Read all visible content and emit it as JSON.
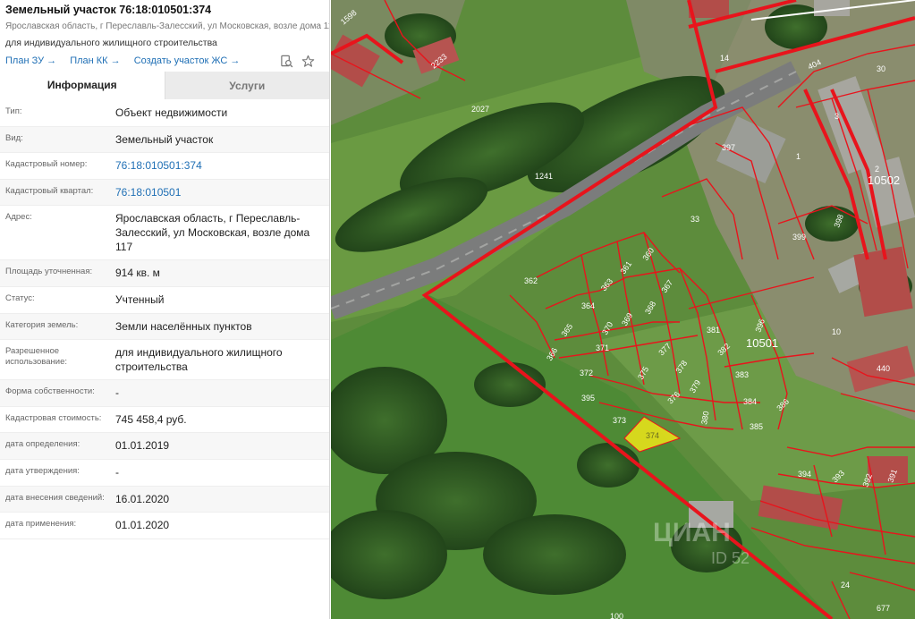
{
  "header": {
    "title": "Земельный участок 76:18:010501:374",
    "address_line": "Ярославская область, г Переславль-Залесский, ул Московская, возле дома 117",
    "purpose": "для индивидуального жилищного строительства",
    "links": [
      {
        "label": "План ЗУ →"
      },
      {
        "label": "План КК →"
      },
      {
        "label": "Создать участок ЖС →"
      }
    ],
    "icons": [
      "document-search-icon",
      "star-icon"
    ]
  },
  "tabs": [
    {
      "label": "Информация",
      "active": true
    },
    {
      "label": "Услуги",
      "active": false
    }
  ],
  "info_rows": [
    {
      "label": "Тип:",
      "value": "Объект недвижимости",
      "link": false
    },
    {
      "label": "Вид:",
      "value": "Земельный участок",
      "link": false
    },
    {
      "label": "Кадастровый номер:",
      "value": "76:18:010501:374",
      "link": true
    },
    {
      "label": "Кадастровый квартал:",
      "value": "76:18:010501",
      "link": true
    },
    {
      "label": "Адрес:",
      "value": "Ярославская область, г Переславль-Залесский, ул Московская, возле дома 117",
      "link": false
    },
    {
      "label": "Площадь уточненная:",
      "value": "914 кв. м",
      "link": false
    },
    {
      "label": "Статус:",
      "value": "Учтенный",
      "link": false
    },
    {
      "label": "Категория земель:",
      "value": "Земли населённых пунктов",
      "link": false
    },
    {
      "label": "Разрешенное использование:",
      "value": "для индивидуального жилищного строительства",
      "link": false
    },
    {
      "label": "Форма собственности:",
      "value": "-",
      "link": false
    },
    {
      "label": "Кадастровая стоимость:",
      "value": "745 458,4 руб.",
      "link": false
    },
    {
      "label": "дата определения:",
      "value": "01.01.2019",
      "link": false
    },
    {
      "label": "дата утверждения:",
      "value": "-",
      "link": false
    },
    {
      "label": "дата внесения сведений:",
      "value": "16.01.2020",
      "link": false
    },
    {
      "label": "дата применения:",
      "value": "01.01.2020",
      "link": false
    }
  ],
  "map": {
    "selected_parcel": "374",
    "quarter_labels": [
      "10501",
      "10502"
    ],
    "parcel_labels": [
      "1598",
      "2233",
      "2027",
      "1241",
      "397",
      "33",
      "362",
      "361",
      "360",
      "363",
      "367",
      "364",
      "369",
      "368",
      "370",
      "365",
      "371",
      "366",
      "372",
      "377",
      "375",
      "378",
      "379",
      "376",
      "395",
      "373",
      "380",
      "381",
      "382",
      "396",
      "383",
      "384",
      "385",
      "386",
      "10",
      "440",
      "399",
      "398",
      "394",
      "393",
      "392",
      "391",
      "24",
      "677",
      "100",
      "1",
      "2",
      "3",
      "30",
      "404",
      "14"
    ],
    "watermark": "ЦИАН",
    "watermark_id": "ID 52",
    "colors": {
      "boundary": "#e8141c",
      "selected_fill": "#e9e21a",
      "vegetation": "#4a7a34"
    }
  }
}
